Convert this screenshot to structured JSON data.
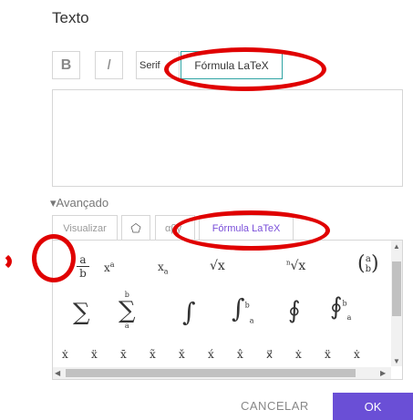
{
  "dialog": {
    "title": "Texto",
    "toolbar": {
      "bold": "B",
      "italic": "I",
      "serif": "Serif",
      "latex": "Fórmula LaTeX"
    },
    "advanced_label": "▾Avançado",
    "tabs": {
      "visualizar": "Visualizar",
      "abc": "αβγ",
      "latex": "Fórmula LaTeX"
    },
    "actions": {
      "cancel": "CANCELAR",
      "ok": "OK"
    }
  },
  "palette": {
    "row1": [
      "a/b",
      "xᵃ",
      "xₐ",
      "√x",
      "ⁿ√x",
      "(a b)"
    ],
    "row2": [
      "∑",
      "∑ₐᵇ",
      "∫",
      "∫ₐᵇ",
      "∮",
      "∮ₐᵇ"
    ],
    "row3": [
      "ẋ",
      "ẍ",
      "x̄",
      "x̃",
      "x̌",
      "x́",
      "x̂",
      "x⃗",
      "ẋ",
      "ẍ",
      "ẋ"
    ]
  },
  "highlight_color": "#e00000",
  "accent_color": "#6a4fd6"
}
